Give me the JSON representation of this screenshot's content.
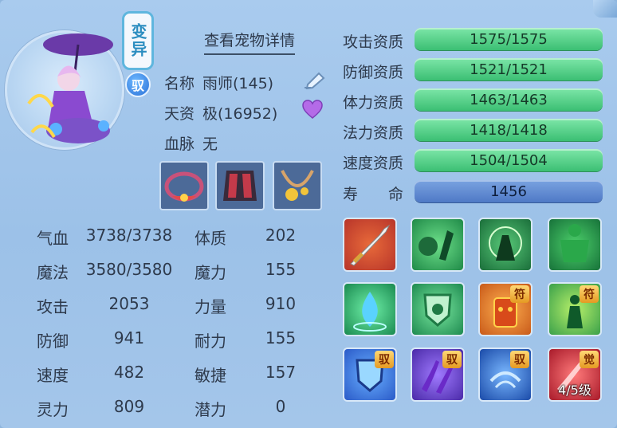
{
  "header": {
    "title": "查看宠物详情",
    "mutate_tag": "变异",
    "yu_tag": "驭"
  },
  "pet": {
    "name_label": "名称",
    "name_value": "雨师(145)",
    "talent_label": "天资",
    "talent_value": "极(16952)",
    "bloodline_label": "血脉",
    "bloodline_value": "无"
  },
  "stats": {
    "hp_label": "气血",
    "hp_value": "3738/3738",
    "mp_label": "魔法",
    "mp_value": "3580/3580",
    "atk_label": "攻击",
    "atk_value": "2053",
    "def_label": "防御",
    "def_value": "941",
    "spd_label": "速度",
    "spd_value": "482",
    "spirit_label": "灵力",
    "spirit_value": "809",
    "con_label": "体质",
    "con_value": "202",
    "mag_label": "魔力",
    "mag_value": "155",
    "str_label": "力量",
    "str_value": "910",
    "end_label": "耐力",
    "end_value": "155",
    "agi_label": "敏捷",
    "agi_value": "157",
    "pot_label": "潜力",
    "pot_value": "0"
  },
  "aptitudes": {
    "atk_label": "攻击资质",
    "atk_value": "1575/1575",
    "def_label": "防御资质",
    "def_value": "1521/1521",
    "hp_label": "体力资质",
    "hp_value": "1463/1463",
    "mag_label": "法力资质",
    "mag_value": "1418/1418",
    "spd_label": "速度资质",
    "spd_value": "1504/1504",
    "life_label": "寿　　命",
    "life_value": "1456"
  },
  "skills": {
    "badge_fu": "符",
    "badge_yu": "驭",
    "badge_jue": "觉",
    "awaken_level": "4/5级"
  },
  "colors": {
    "accent_green": "#3bbf73",
    "accent_blue": "#4f79c6",
    "panel_bg": "#a9cbee"
  }
}
